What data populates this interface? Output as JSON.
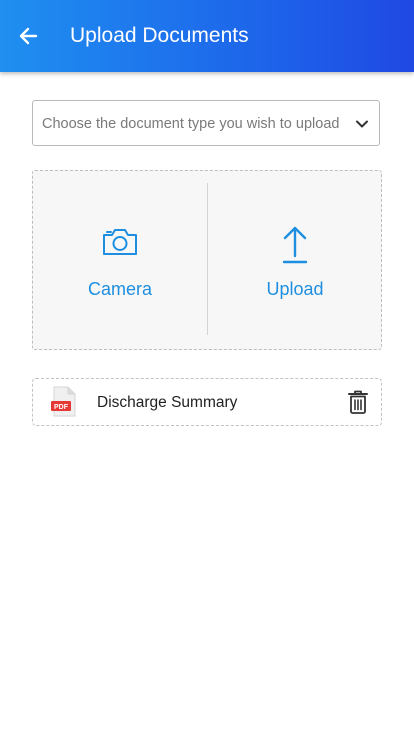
{
  "header": {
    "title": "Upload Documents",
    "back_icon": "arrow-left-icon"
  },
  "document_type": {
    "placeholder": "Choose the document type you wish to upload",
    "icon": "chevron-down-icon"
  },
  "upload_options": {
    "camera": {
      "label": "Camera",
      "icon": "camera-icon"
    },
    "upload": {
      "label": "Upload",
      "icon": "upload-arrow-icon"
    }
  },
  "files": [
    {
      "name": "Discharge Summary",
      "type_badge": "PDF",
      "icon": "pdf-file-icon",
      "action_icon": "trash-icon"
    }
  ],
  "colors": {
    "header_start": "#1f8ff0",
    "header_end": "#2048e3",
    "accent": "#1e8fe0",
    "pdf_red": "#e53935"
  }
}
